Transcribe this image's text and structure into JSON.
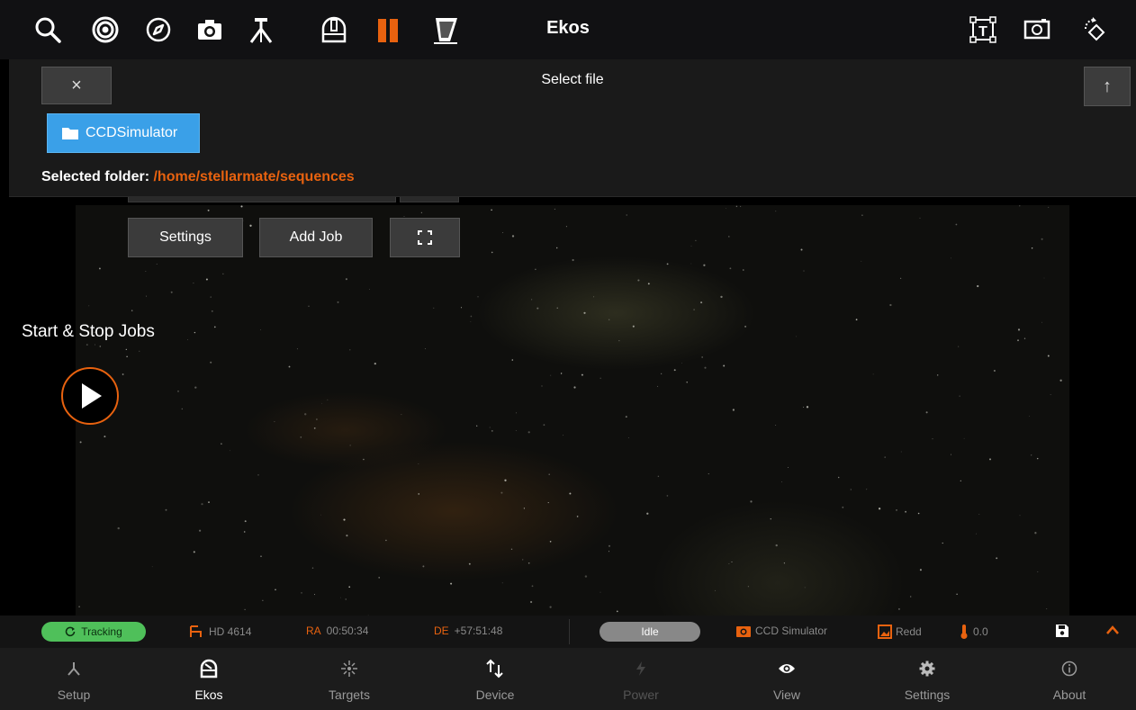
{
  "topbar": {
    "title": "Ekos",
    "icons": [
      "search-icon",
      "target-icon",
      "compass-icon",
      "camera-icon",
      "mount-icon",
      "observatory-icon",
      "scheduler-icon",
      "focuser-icon",
      "text-frame-icon",
      "frame-icon",
      "rotate-icon"
    ],
    "accent": "#e8620f"
  },
  "dialog": {
    "title": "Select file",
    "close_label": "×",
    "up_label": "↑",
    "folder_name": "CCDSimulator",
    "selected_label": "Selected folder:",
    "selected_path": "/home/stellarmate/sequences"
  },
  "controls": {
    "settings_label": "Settings",
    "add_job_label": "Add Job",
    "start_stop_label": "Start & Stop Jobs"
  },
  "status": {
    "tracking": "Tracking",
    "target": "HD 4614",
    "ra_label": "RA",
    "ra_value": "00:50:34",
    "de_label": "DE",
    "de_value": "+57:51:48",
    "state": "Idle",
    "camera": "CCD Simulator",
    "filter": "Redd",
    "temperature": "0.0",
    "colors": {
      "tracking": "#4fc05a",
      "idle": "#888888"
    }
  },
  "nav": {
    "items": [
      {
        "label": "Setup",
        "icon": "setup-icon"
      },
      {
        "label": "Ekos",
        "icon": "ekos-icon"
      },
      {
        "label": "Targets",
        "icon": "targets-icon"
      },
      {
        "label": "Device",
        "icon": "device-icon"
      },
      {
        "label": "Power",
        "icon": "power-icon"
      },
      {
        "label": "View",
        "icon": "view-icon"
      },
      {
        "label": "Settings",
        "icon": "settings-icon"
      },
      {
        "label": "About",
        "icon": "about-icon"
      }
    ]
  }
}
